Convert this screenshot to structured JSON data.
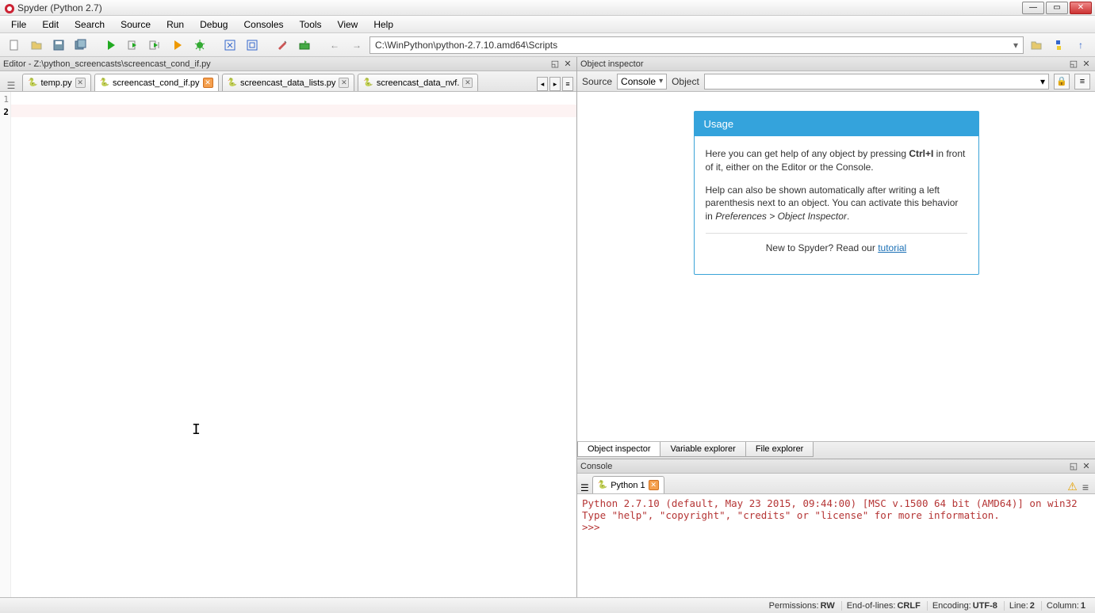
{
  "window": {
    "title": "Spyder (Python 2.7)"
  },
  "menu": [
    "File",
    "Edit",
    "Search",
    "Source",
    "Run",
    "Debug",
    "Consoles",
    "Tools",
    "View",
    "Help"
  ],
  "toolbar": {
    "path": "C:\\WinPython\\python-2.7.10.amd64\\Scripts"
  },
  "editor": {
    "pane_title": "Editor - Z:\\python_screencasts\\screencast_cond_if.py",
    "tabs": [
      {
        "label": "temp.py",
        "dirty": false,
        "active": false
      },
      {
        "label": "screencast_cond_if.py",
        "dirty": true,
        "active": true
      },
      {
        "label": "screencast_data_lists.py",
        "dirty": false,
        "active": false
      },
      {
        "label": "screencast_data_nvf.",
        "dirty": false,
        "active": false
      }
    ],
    "gutter_lines": [
      "1",
      "2"
    ],
    "current_line_index": 1
  },
  "inspector": {
    "pane_title": "Object inspector",
    "source_label": "Source",
    "source_value": "Console",
    "object_label": "Object",
    "object_value": "",
    "usage": {
      "heading": "Usage",
      "p1_pre": "Here you can get help of any object by pressing ",
      "p1_key": "Ctrl+I",
      "p1_post": " in front of it, either on the Editor or the Console.",
      "p2_pre": "Help can also be shown automatically after writing a left parenthesis next to an object. You can activate this behavior in ",
      "p2_em": "Preferences > Object Inspector",
      "p2_post": ".",
      "tutorial_pre": "New to Spyder? Read our ",
      "tutorial_link": "tutorial"
    },
    "bottom_tabs": [
      "Object inspector",
      "Variable explorer",
      "File explorer"
    ]
  },
  "console": {
    "pane_title": "Console",
    "tab_label": "Python 1",
    "output": "Python 2.7.10 (default, May 23 2015, 09:44:00) [MSC v.1500 64 bit (AMD64)] on win32\nType \"help\", \"copyright\", \"credits\" or \"license\" for more information.\n>>> "
  },
  "statusbar": {
    "permissions_label": "Permissions:",
    "permissions_val": "RW",
    "eol_label": "End-of-lines:",
    "eol_val": "CRLF",
    "encoding_label": "Encoding:",
    "encoding_val": "UTF-8",
    "line_label": "Line:",
    "line_val": "2",
    "col_label": "Column:",
    "col_val": "1"
  }
}
